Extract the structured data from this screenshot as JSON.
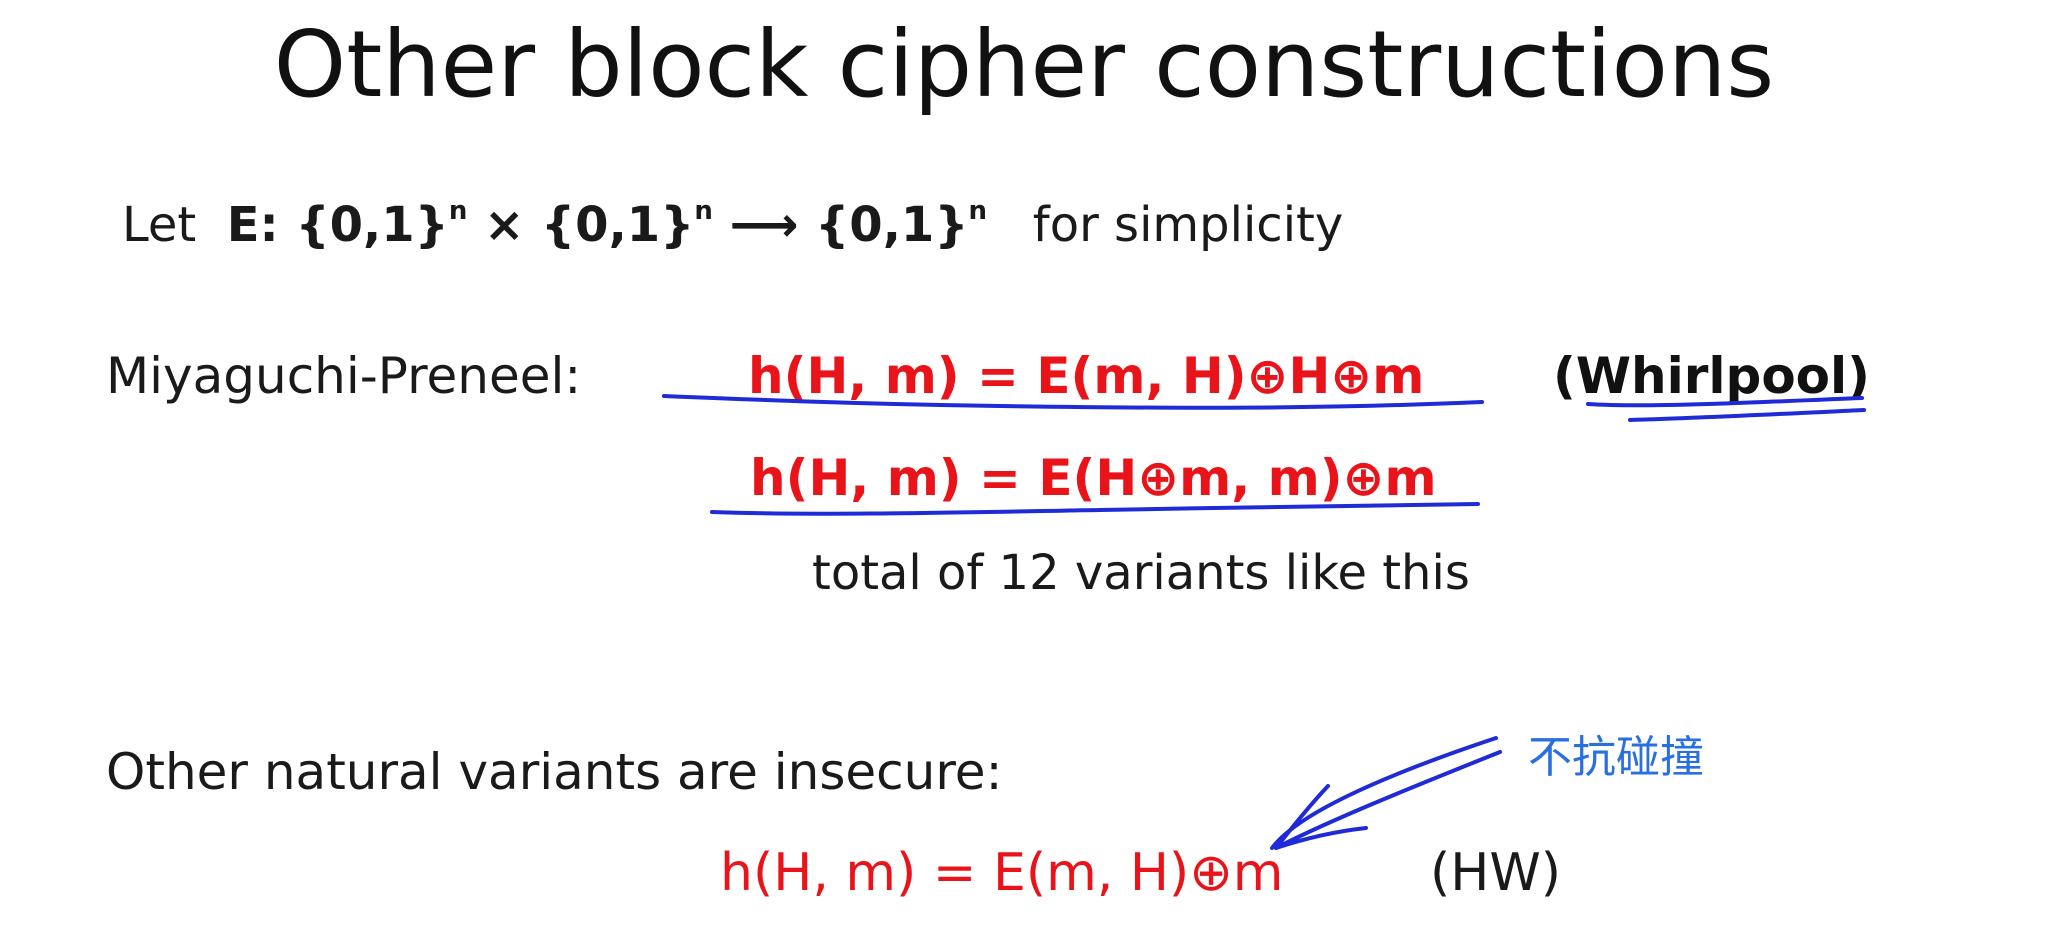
{
  "slide": {
    "title": "Other block cipher constructions",
    "let": {
      "prefix": "Let",
      "e_head": "E: {0,1}",
      "sup1": "n",
      "times": " × {0,1}",
      "sup2": "n",
      "arrow": " ⟶ {0,1}",
      "sup3": "n",
      "suffix": "for simplicity"
    },
    "mp_label": "Miyaguchi-Preneel:",
    "formula1": "h(H, m) = E(m, H)⊕H⊕m",
    "whirlpool": "(Whirlpool)",
    "formula2": "h(H, m) =  E(H⊕m, m)⊕m",
    "total_variants": "total of 12 variants like this",
    "insecure_label": "Other natural variants are insecure:",
    "formula3": "h(H, m) = E(m, H)⊕m",
    "hw": "(HW)",
    "annotation": "不抗碰撞",
    "ink_color": "#1e2bd6",
    "red_color": "#e8141a",
    "annotation_color": "#2a6fe0"
  }
}
